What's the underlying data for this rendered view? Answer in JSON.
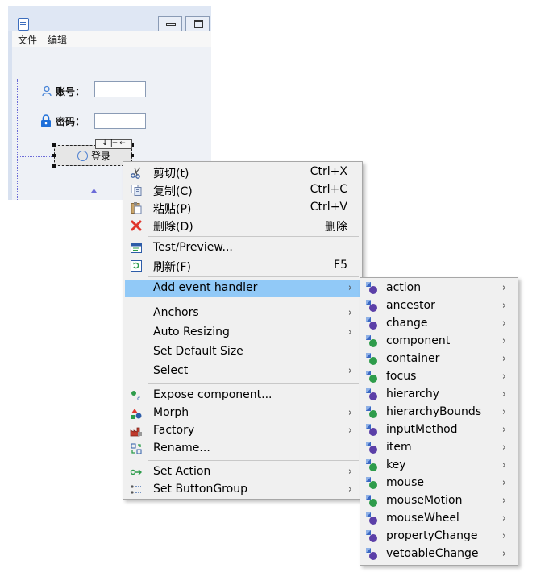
{
  "designer": {
    "menubar": [
      "文件",
      "编辑"
    ],
    "account_label": "账号：",
    "password_label": "密码：",
    "login_button": "登录"
  },
  "context_menu": {
    "items": [
      {
        "label": "剪切(t)",
        "shortcut": "Ctrl+X",
        "icon": "scissors-icon"
      },
      {
        "label": "复制(C)",
        "shortcut": "Ctrl+C",
        "icon": "copy-icon"
      },
      {
        "label": "粘贴(P)",
        "shortcut": "Ctrl+V",
        "icon": "paste-icon"
      },
      {
        "label": "删除(D)",
        "shortcut": "删除",
        "icon": "delete-icon"
      },
      {
        "label": "Test/Preview...",
        "shortcut": "",
        "icon": "preview-icon"
      },
      {
        "label": "刷新(F)",
        "shortcut": "F5",
        "icon": "refresh-icon"
      },
      {
        "label": "Add event handler",
        "shortcut": "",
        "icon": "",
        "submenu": true,
        "highlighted": true
      },
      {
        "label": "Anchors",
        "submenu": true
      },
      {
        "label": "Auto Resizing",
        "submenu": true
      },
      {
        "label": "Set Default Size"
      },
      {
        "label": "Select",
        "submenu": true
      },
      {
        "label": "Expose component...",
        "icon": "expose-icon"
      },
      {
        "label": "Morph",
        "submenu": true,
        "icon": "morph-icon"
      },
      {
        "label": "Factory",
        "submenu": true,
        "icon": "factory-icon"
      },
      {
        "label": "Rename...",
        "icon": "rename-icon"
      },
      {
        "label": "Set Action",
        "submenu": true,
        "icon": "action-icon"
      },
      {
        "label": "Set ButtonGroup",
        "submenu": true,
        "icon": "button-group-icon"
      }
    ]
  },
  "event_submenu": {
    "items": [
      {
        "label": "action",
        "kind": "interface"
      },
      {
        "label": "ancestor",
        "kind": "interface"
      },
      {
        "label": "change",
        "kind": "interface"
      },
      {
        "label": "component",
        "kind": "class"
      },
      {
        "label": "container",
        "kind": "class"
      },
      {
        "label": "focus",
        "kind": "class"
      },
      {
        "label": "hierarchy",
        "kind": "interface"
      },
      {
        "label": "hierarchyBounds",
        "kind": "class"
      },
      {
        "label": "inputMethod",
        "kind": "interface"
      },
      {
        "label": "item",
        "kind": "interface"
      },
      {
        "label": "key",
        "kind": "class"
      },
      {
        "label": "mouse",
        "kind": "class"
      },
      {
        "label": "mouseMotion",
        "kind": "class"
      },
      {
        "label": "mouseWheel",
        "kind": "interface"
      },
      {
        "label": "propertyChange",
        "kind": "interface"
      },
      {
        "label": "vetoableChange",
        "kind": "interface"
      }
    ]
  },
  "colors": {
    "highlight": "#91c9f7",
    "interface_icon": "#5b3fa8",
    "class_icon": "#2e9c4b"
  }
}
